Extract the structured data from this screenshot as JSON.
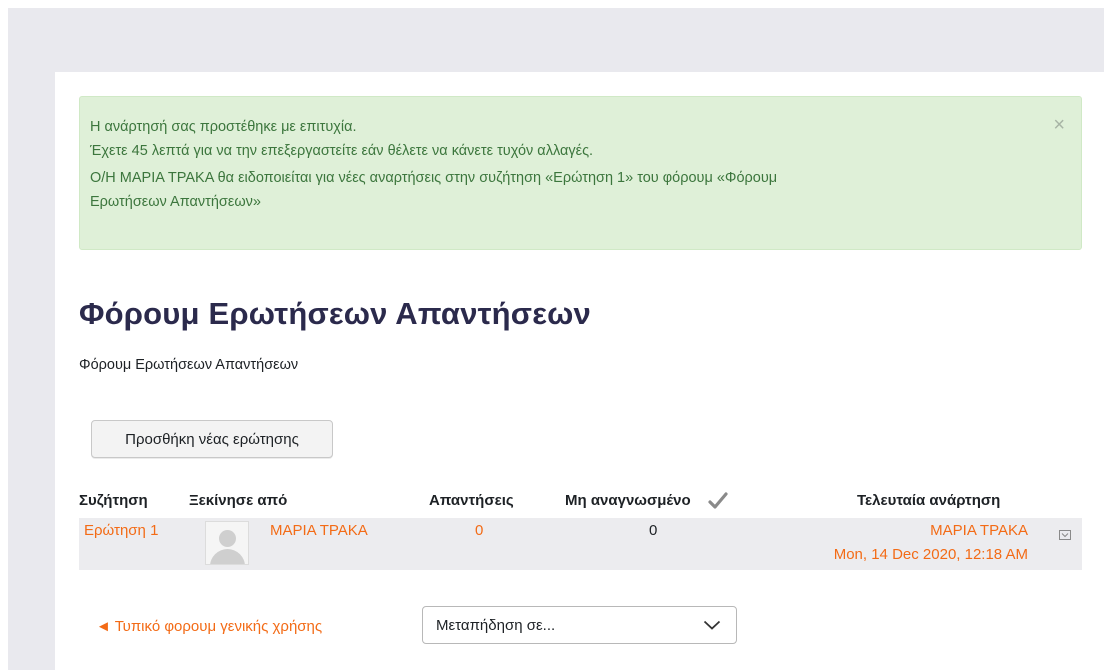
{
  "alert": {
    "line1": "Η ανάρτησή σας προστέθηκε με επιτυχία.",
    "line2": "Έχετε 45 λεπτά για να την επεξεργαστείτε εάν θέλετε να κάνετε τυχόν αλλαγές.",
    "line3a": "Ο/Η ΜΑΡΙΑ ΤΡΑΚΑ θα ειδοποιείται για νέες αναρτήσεις στην συζήτηση «Ερώτηση 1» του φόρουμ «Φόρουμ",
    "line3b": "Ερωτήσεων Απαντήσεων»",
    "close": "×"
  },
  "forum": {
    "title": "Φόρουμ Ερωτήσεων Απαντήσεων",
    "description": "Φόρουμ Ερωτήσεων Απαντήσεων",
    "add_button": "Προσθήκη νέας ερώτησης"
  },
  "table": {
    "headers": {
      "discussion": "Συζήτηση",
      "started_by": "Ξεκίνησε από",
      "replies": "Απαντήσεις",
      "unread": "Μη αναγνωσμένο",
      "last_post": "Τελευταία ανάρτηση"
    },
    "rows": [
      {
        "discussion": "Ερώτηση 1",
        "started_by": "ΜΑΡΙΑ ΤΡΑΚΑ",
        "replies": "0",
        "unread": "0",
        "last_post_author": "ΜΑΡΙΑ ΤΡΑΚΑ",
        "last_post_date": "Mon, 14 Dec 2020, 12:18 AM"
      }
    ]
  },
  "footer_nav": {
    "prev_link": "◄ Τυπικό φορουμ γενικής χρήσης",
    "jump_select": "Μεταπήδηση σε..."
  },
  "icons": {
    "close": "close-icon",
    "check": "checkmark-icon",
    "avatar": "default-user-avatar",
    "subscribe": "discussion-subscribe-icon",
    "chevron": "chevron-down-icon"
  },
  "colors": {
    "link": "#f36b16",
    "heading": "#2b2a4c",
    "alert_bg": "#dff0d8",
    "alert_text": "#3c763d",
    "row_bg": "#ececef"
  }
}
